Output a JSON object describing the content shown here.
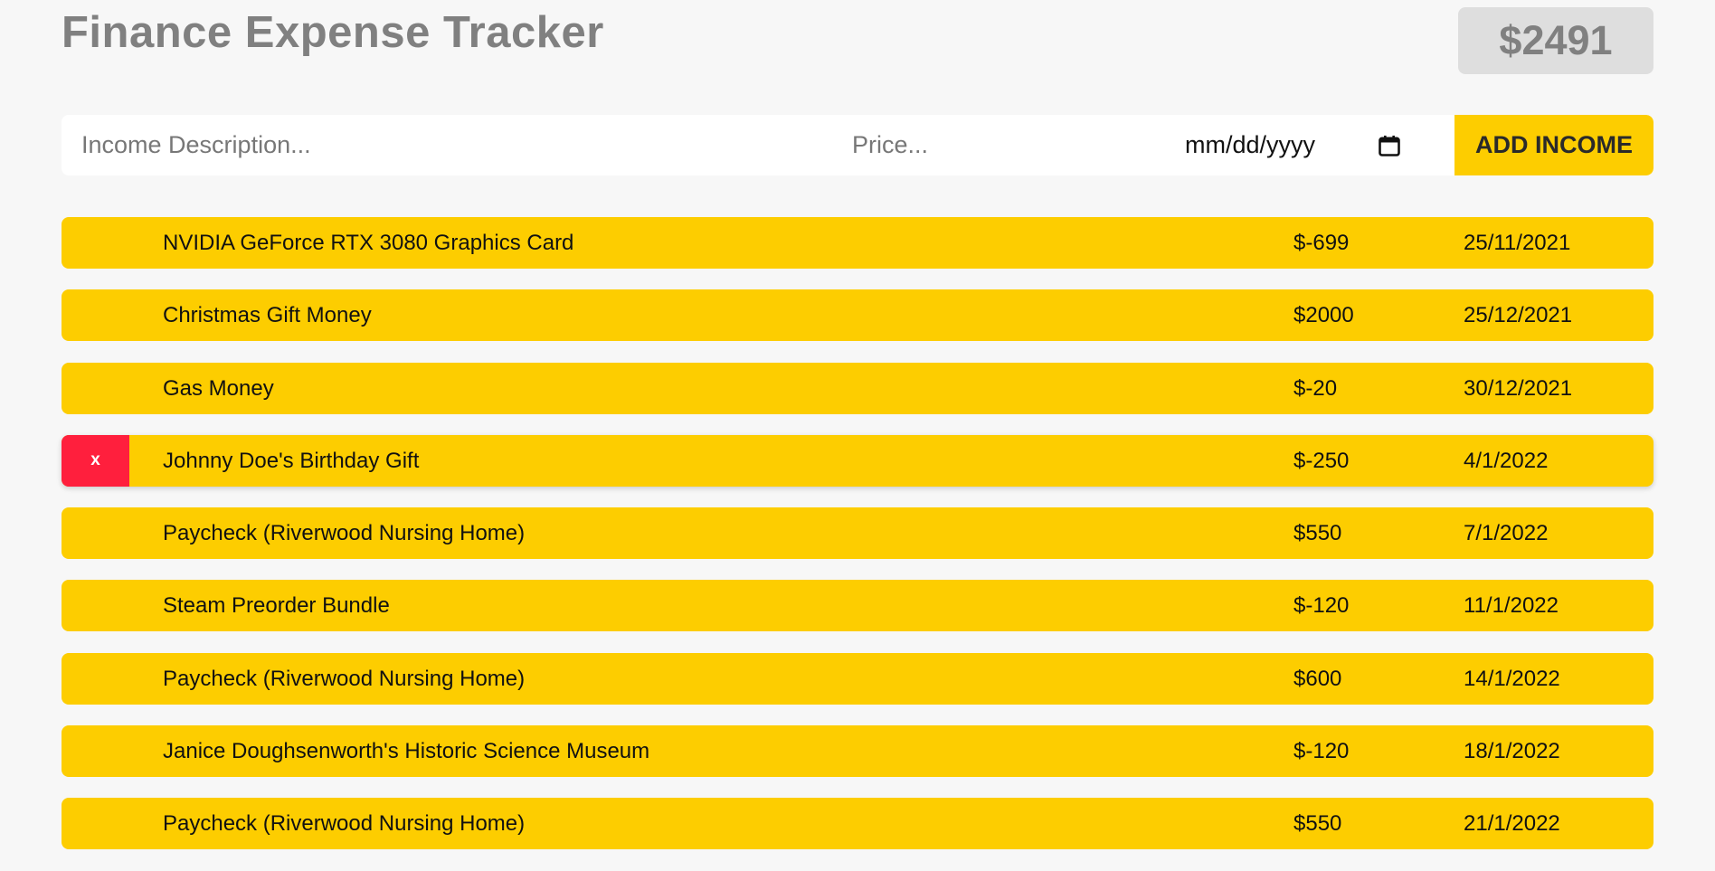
{
  "header": {
    "title": "Finance Expense Tracker",
    "total": "$2491"
  },
  "form": {
    "description_placeholder": "Income Description...",
    "price_placeholder": "Price...",
    "date_placeholder": "mm/dd/yyyy",
    "add_label": "ADD INCOME"
  },
  "entries": [
    {
      "description": "NVIDIA GeForce RTX 3080 Graphics Card",
      "price": "$-699",
      "date": "25/11/2021"
    },
    {
      "description": "Christmas Gift Money",
      "price": "$2000",
      "date": "25/12/2021"
    },
    {
      "description": "Gas Money",
      "price": "$-20",
      "date": "30/12/2021"
    },
    {
      "description": "Johnny Doe's Birthday Gift",
      "price": "$-250",
      "date": "4/1/2022",
      "delete_label": "x"
    },
    {
      "description": "Paycheck (Riverwood Nursing Home)",
      "price": "$550",
      "date": "7/1/2022"
    },
    {
      "description": "Steam Preorder Bundle",
      "price": "$-120",
      "date": "11/1/2022"
    },
    {
      "description": "Paycheck (Riverwood Nursing Home)",
      "price": "$600",
      "date": "14/1/2022"
    },
    {
      "description": "Janice Doughsenworth's Historic Science Museum",
      "price": "$-120",
      "date": "18/1/2022"
    },
    {
      "description": "Paycheck (Riverwood Nursing Home)",
      "price": "$550",
      "date": "21/1/2022"
    }
  ],
  "colors": {
    "background": "#f7f7f7",
    "accent": "#fdcd00",
    "delete": "#ff1f3d",
    "muted": "#808080"
  },
  "icons": {
    "date_picker": "calendar-icon"
  }
}
